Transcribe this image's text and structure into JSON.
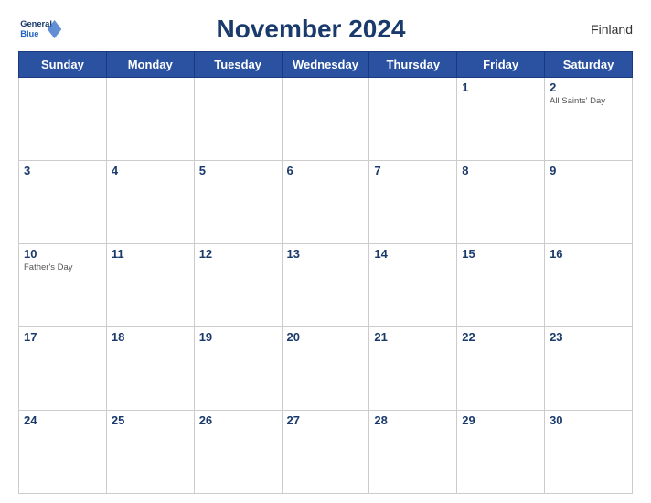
{
  "header": {
    "title": "November 2024",
    "country": "Finland",
    "logo_general": "General",
    "logo_blue": "Blue"
  },
  "days_of_week": [
    "Sunday",
    "Monday",
    "Tuesday",
    "Wednesday",
    "Thursday",
    "Friday",
    "Saturday"
  ],
  "weeks": [
    [
      {
        "day": "",
        "holiday": ""
      },
      {
        "day": "",
        "holiday": ""
      },
      {
        "day": "",
        "holiday": ""
      },
      {
        "day": "",
        "holiday": ""
      },
      {
        "day": "",
        "holiday": ""
      },
      {
        "day": "1",
        "holiday": ""
      },
      {
        "day": "2",
        "holiday": "All Saints' Day"
      }
    ],
    [
      {
        "day": "3",
        "holiday": ""
      },
      {
        "day": "4",
        "holiday": ""
      },
      {
        "day": "5",
        "holiday": ""
      },
      {
        "day": "6",
        "holiday": ""
      },
      {
        "day": "7",
        "holiday": ""
      },
      {
        "day": "8",
        "holiday": ""
      },
      {
        "day": "9",
        "holiday": ""
      }
    ],
    [
      {
        "day": "10",
        "holiday": "Father's Day"
      },
      {
        "day": "11",
        "holiday": ""
      },
      {
        "day": "12",
        "holiday": ""
      },
      {
        "day": "13",
        "holiday": ""
      },
      {
        "day": "14",
        "holiday": ""
      },
      {
        "day": "15",
        "holiday": ""
      },
      {
        "day": "16",
        "holiday": ""
      }
    ],
    [
      {
        "day": "17",
        "holiday": ""
      },
      {
        "day": "18",
        "holiday": ""
      },
      {
        "day": "19",
        "holiday": ""
      },
      {
        "day": "20",
        "holiday": ""
      },
      {
        "day": "21",
        "holiday": ""
      },
      {
        "day": "22",
        "holiday": ""
      },
      {
        "day": "23",
        "holiday": ""
      }
    ],
    [
      {
        "day": "24",
        "holiday": ""
      },
      {
        "day": "25",
        "holiday": ""
      },
      {
        "day": "26",
        "holiday": ""
      },
      {
        "day": "27",
        "holiday": ""
      },
      {
        "day": "28",
        "holiday": ""
      },
      {
        "day": "29",
        "holiday": ""
      },
      {
        "day": "30",
        "holiday": ""
      }
    ]
  ]
}
